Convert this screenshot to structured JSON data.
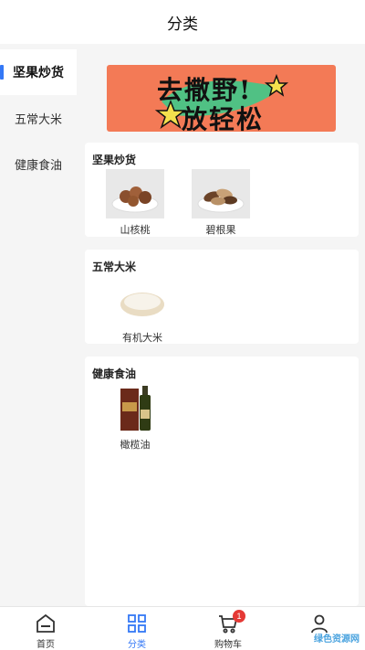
{
  "header": {
    "title": "分类"
  },
  "sidebar": {
    "items": [
      {
        "label": "坚果炒货",
        "active": true
      },
      {
        "label": "五常大米",
        "active": false
      },
      {
        "label": "健康食油",
        "active": false
      }
    ]
  },
  "banner": {
    "line1": "去撒野!",
    "line2": "放轻松"
  },
  "sections": [
    {
      "title": "坚果炒货",
      "products": [
        {
          "name": "山核桃"
        },
        {
          "name": "碧根果"
        }
      ]
    },
    {
      "title": "五常大米",
      "products": [
        {
          "name": "有机大米"
        }
      ]
    },
    {
      "title": "健康食油",
      "products": [
        {
          "name": "橄榄油"
        }
      ]
    }
  ],
  "tabbar": {
    "items": [
      {
        "label": "首页",
        "icon": "home-icon"
      },
      {
        "label": "分类",
        "icon": "grid-icon",
        "active": true
      },
      {
        "label": "购物车",
        "icon": "cart-icon",
        "badge": "1"
      },
      {
        "label": "",
        "icon": "user-icon"
      }
    ]
  },
  "watermark": "绿色资源网",
  "colors": {
    "accent": "#3478f6",
    "badge": "#e53935",
    "banner": "#f37a56"
  }
}
